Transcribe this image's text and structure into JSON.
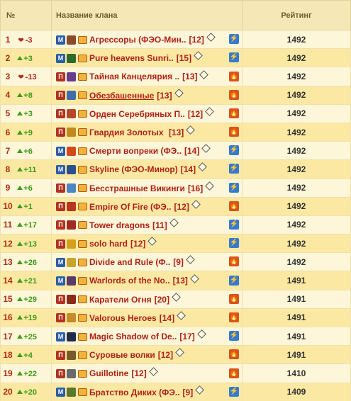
{
  "header": {
    "num": "№",
    "clan": "Название клана",
    "rating": "Рейтинг"
  },
  "rows": [
    {
      "rank": "1",
      "dir": "down",
      "change": "-3",
      "faction": "blue",
      "name": "Агрессоры (ФЭО-Мин..",
      "level": "[12]",
      "side": "light",
      "rating": "1492"
    },
    {
      "rank": "2",
      "dir": "up",
      "change": "+3",
      "faction": "blue",
      "name": "Pure heavens Sunri..",
      "level": "[15]",
      "side": "light",
      "rating": "1492"
    },
    {
      "rank": "3",
      "dir": "down",
      "change": "-13",
      "faction": "red",
      "name": "Тайная Канцелярия ..",
      "level": "[13]",
      "side": "fire",
      "rating": "1492"
    },
    {
      "rank": "4",
      "dir": "up",
      "change": "+8",
      "faction": "red",
      "name": "Обезбашенные",
      "level": "[13]",
      "side": "fire",
      "rating": "1492",
      "underline": true
    },
    {
      "rank": "5",
      "dir": "up",
      "change": "+3",
      "faction": "red",
      "name": "Орден Серебряных П..",
      "level": "[12]",
      "side": "fire",
      "rating": "1492"
    },
    {
      "rank": "6",
      "dir": "up",
      "change": "+9",
      "faction": "red",
      "name": "Гвардия Золотых ",
      "level": "[13]",
      "side": "fire",
      "rating": "1492"
    },
    {
      "rank": "7",
      "dir": "up",
      "change": "+6",
      "faction": "blue",
      "name": "Смерти вопреки (ФЭ..",
      "level": "[14]",
      "side": "light",
      "rating": "1492"
    },
    {
      "rank": "8",
      "dir": "up",
      "change": "+11",
      "faction": "blue",
      "name": "Skyline (ФЭО-Минор)",
      "level": "[14]",
      "side": "light",
      "rating": "1492"
    },
    {
      "rank": "9",
      "dir": "up",
      "change": "+6",
      "faction": "red",
      "name": "Бесстрашные Викинги",
      "level": "[16]",
      "side": "light",
      "rating": "1492"
    },
    {
      "rank": "10",
      "dir": "up",
      "change": "+1",
      "faction": "red",
      "name": "Empire Of Fire (ФЭ..",
      "level": "[12]",
      "side": "fire",
      "rating": "1492"
    },
    {
      "rank": "11",
      "dir": "up",
      "change": "+17",
      "faction": "red",
      "name": "Tower dragons",
      "level": "[11]",
      "side": "light",
      "rating": "1492"
    },
    {
      "rank": "12",
      "dir": "up",
      "change": "+13",
      "faction": "red",
      "name": "solo hard",
      "level": "[12]",
      "side": "light",
      "rating": "1492"
    },
    {
      "rank": "13",
      "dir": "up",
      "change": "+26",
      "faction": "blue",
      "name": "Divide and Rule (Ф..",
      "level": "[9]",
      "side": "fire",
      "rating": "1492"
    },
    {
      "rank": "14",
      "dir": "up",
      "change": "+21",
      "faction": "blue",
      "name": "Warlords of the No..",
      "level": "[13]",
      "side": "light",
      "rating": "1491"
    },
    {
      "rank": "15",
      "dir": "up",
      "change": "+29",
      "faction": "red",
      "name": "Каратели Огня",
      "level": "[20]",
      "side": "fire",
      "rating": "1491"
    },
    {
      "rank": "16",
      "dir": "up",
      "change": "+19",
      "faction": "red",
      "name": "Valorous Heroes",
      "level": "[14]",
      "side": "fire",
      "rating": "1491"
    },
    {
      "rank": "17",
      "dir": "up",
      "change": "+25",
      "faction": "blue",
      "name": "Magic Shadow of De..",
      "level": "[17]",
      "side": "light",
      "rating": "1491"
    },
    {
      "rank": "18",
      "dir": "up",
      "change": "+4",
      "faction": "red",
      "name": "Суровые волки",
      "level": "[12]",
      "side": "fire",
      "rating": "1491"
    },
    {
      "rank": "19",
      "dir": "up",
      "change": "+22",
      "faction": "red",
      "name": "Guillotine",
      "level": "[12]",
      "side": "fire",
      "rating": "1410"
    },
    {
      "rank": "20",
      "dir": "up",
      "change": "+20",
      "faction": "blue",
      "name": "Братство Диких (ФЭ..",
      "level": "[9]",
      "side": "light",
      "rating": "1409"
    }
  ],
  "faction_letters": {
    "blue": "M",
    "red": "П"
  },
  "side_glyphs": {
    "light": "⚡",
    "fire": "🔥"
  },
  "colors": {
    "clan_name": "#b02018",
    "up": "#3f9a1a",
    "down": "#b2261e",
    "row_odd": "#fdf6d8",
    "row_even": "#fbe9a3"
  }
}
